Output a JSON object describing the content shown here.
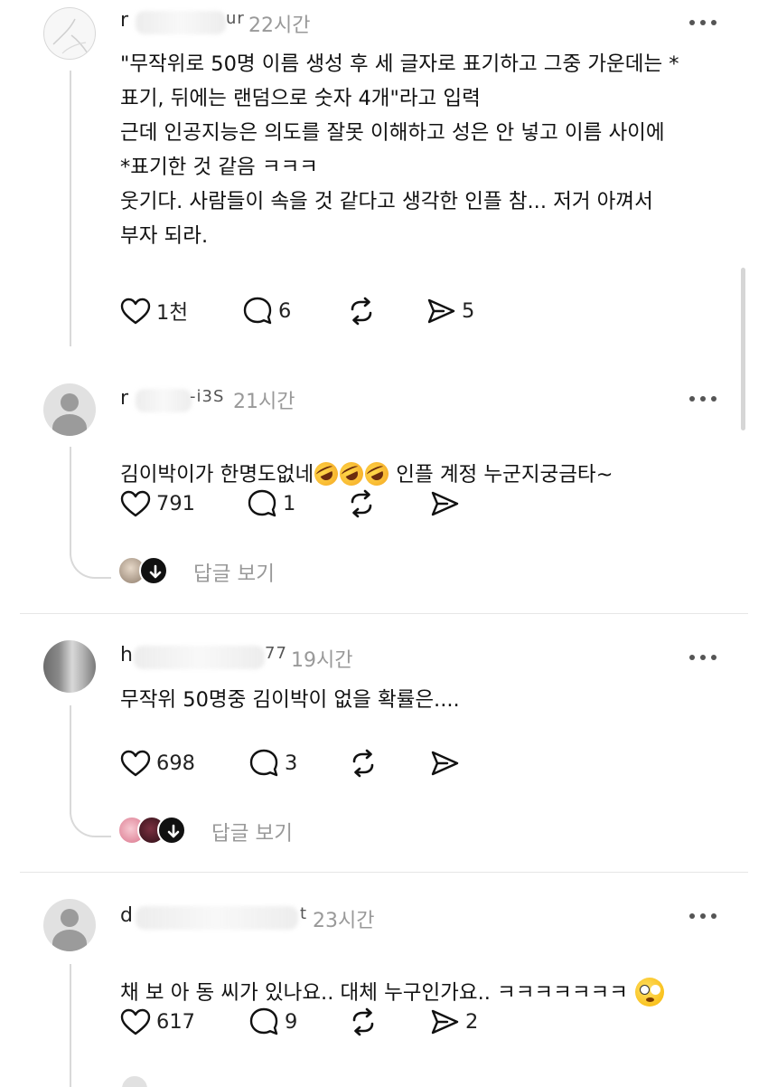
{
  "icons": {
    "like": "heart-icon",
    "reply": "speech-bubble-icon",
    "repost": "repost-icon",
    "share": "send-icon",
    "more": "more-dots-icon",
    "expand": "arrow-down-icon"
  },
  "colors": {
    "text": "#111111",
    "muted": "#999999",
    "thread": "#d9d9d9"
  },
  "posts": [
    {
      "username": "r",
      "username_tail": "ur",
      "time": "22시간",
      "text": "\"무작위로 50명 이름 생성 후 세 글자로 표기하고 그중 가운데는 *\n표기, 뒤에는 랜덤으로 숫자 4개\"라고 입력\n근데 인공지능은 의도를 잘못 이해하고 성은 안 넣고 이름 사이에\n*표기한 것 같음 ㅋㅋㅋ\n웃기다. 사람들이 속을 것 같다고 생각한 인플 참... 저거 아껴서\n부자 되라.",
      "likes": "1천",
      "replies": "6",
      "shares": "5"
    },
    {
      "username": "r",
      "username_tail": "-i3S",
      "time": "21시간",
      "text_before": "김이박이가 한명도없네",
      "text_after": " 인플 계정 누군지궁금타~",
      "likes": "791",
      "replies": "1",
      "view_replies": "답글 보기"
    },
    {
      "username": "h",
      "username_tail": "77",
      "time": "19시간",
      "text": "무작위 50명중 김이박이 없을 확률은....",
      "likes": "698",
      "replies": "3",
      "view_replies": "답글 보기"
    },
    {
      "username": "d",
      "username_tail": "t",
      "time": "23시간",
      "text": "채 보 아 동 씨가 있나요.. 대체 누구인가요.. ㅋㅋㅋㅋㅋㅋㅋ",
      "likes": "617",
      "replies": "9",
      "shares": "2"
    }
  ]
}
